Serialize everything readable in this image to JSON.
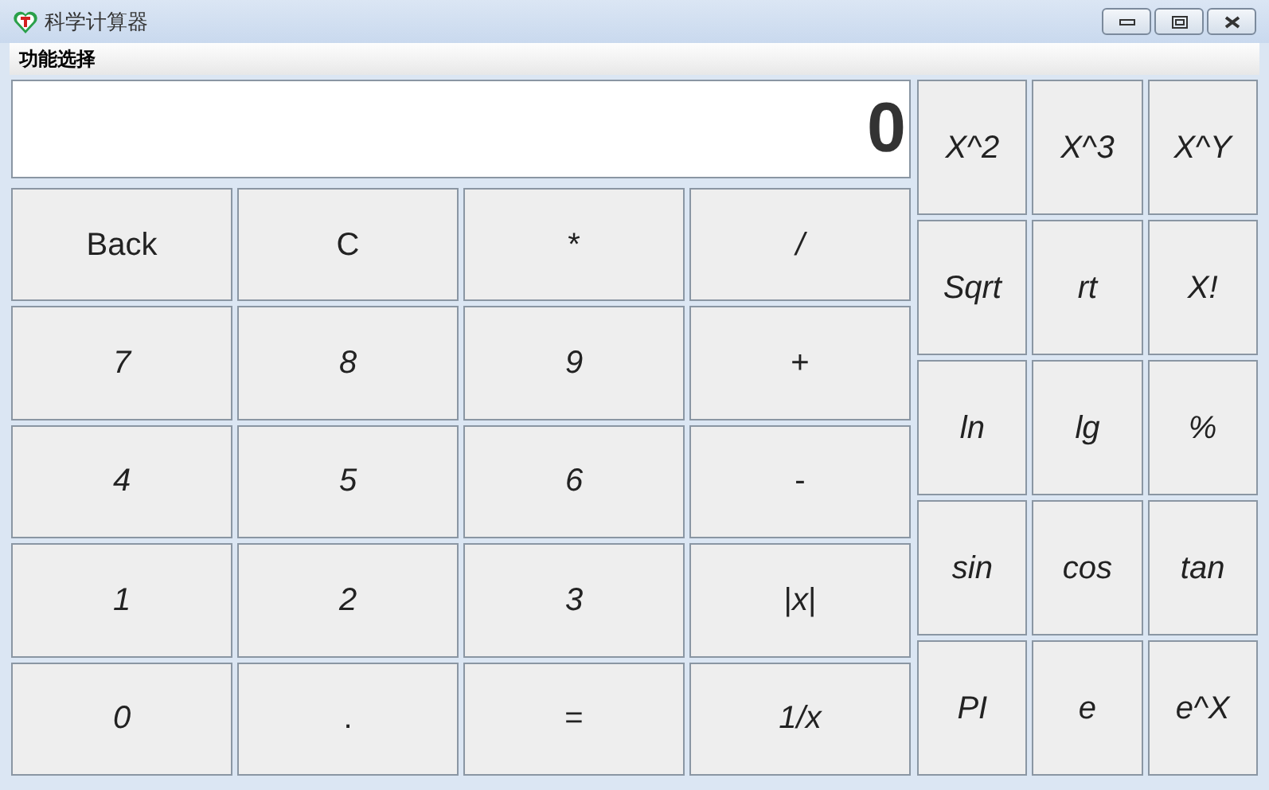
{
  "window": {
    "title": "科学计算器"
  },
  "menu": [
    "功能选择"
  ],
  "display": {
    "value": "0"
  },
  "keypad": [
    {
      "label": "Back",
      "italic": false
    },
    {
      "label": "C",
      "italic": false
    },
    {
      "label": "*",
      "italic": false
    },
    {
      "label": "/",
      "italic": true
    },
    {
      "label": "7",
      "italic": true
    },
    {
      "label": "8",
      "italic": true
    },
    {
      "label": "9",
      "italic": true
    },
    {
      "label": "+",
      "italic": false
    },
    {
      "label": "4",
      "italic": true
    },
    {
      "label": "5",
      "italic": true
    },
    {
      "label": "6",
      "italic": true
    },
    {
      "label": "-",
      "italic": false
    },
    {
      "label": "1",
      "italic": true
    },
    {
      "label": "2",
      "italic": true
    },
    {
      "label": "3",
      "italic": true
    },
    {
      "label": "|*x*|",
      "italic": false
    },
    {
      "label": "0",
      "italic": true
    },
    {
      "label": ".",
      "italic": false
    },
    {
      "label": "=",
      "italic": false
    },
    {
      "label": "1/x",
      "italic": true
    }
  ],
  "functions": [
    {
      "label": "X^2",
      "italic": true
    },
    {
      "label": "X^3",
      "italic": true
    },
    {
      "label": "X^Y",
      "italic": true
    },
    {
      "label": "Sqrt",
      "italic": true
    },
    {
      "label": "rt",
      "italic": true
    },
    {
      "label": "X!",
      "italic": true
    },
    {
      "label": "ln",
      "italic": true
    },
    {
      "label": "lg",
      "italic": true
    },
    {
      "label": "%",
      "italic": true
    },
    {
      "label": "sin",
      "italic": true
    },
    {
      "label": "cos",
      "italic": true
    },
    {
      "label": "tan",
      "italic": true
    },
    {
      "label": "PI",
      "italic": true
    },
    {
      "label": "e",
      "italic": true
    },
    {
      "label": "e^X",
      "italic": true
    }
  ]
}
